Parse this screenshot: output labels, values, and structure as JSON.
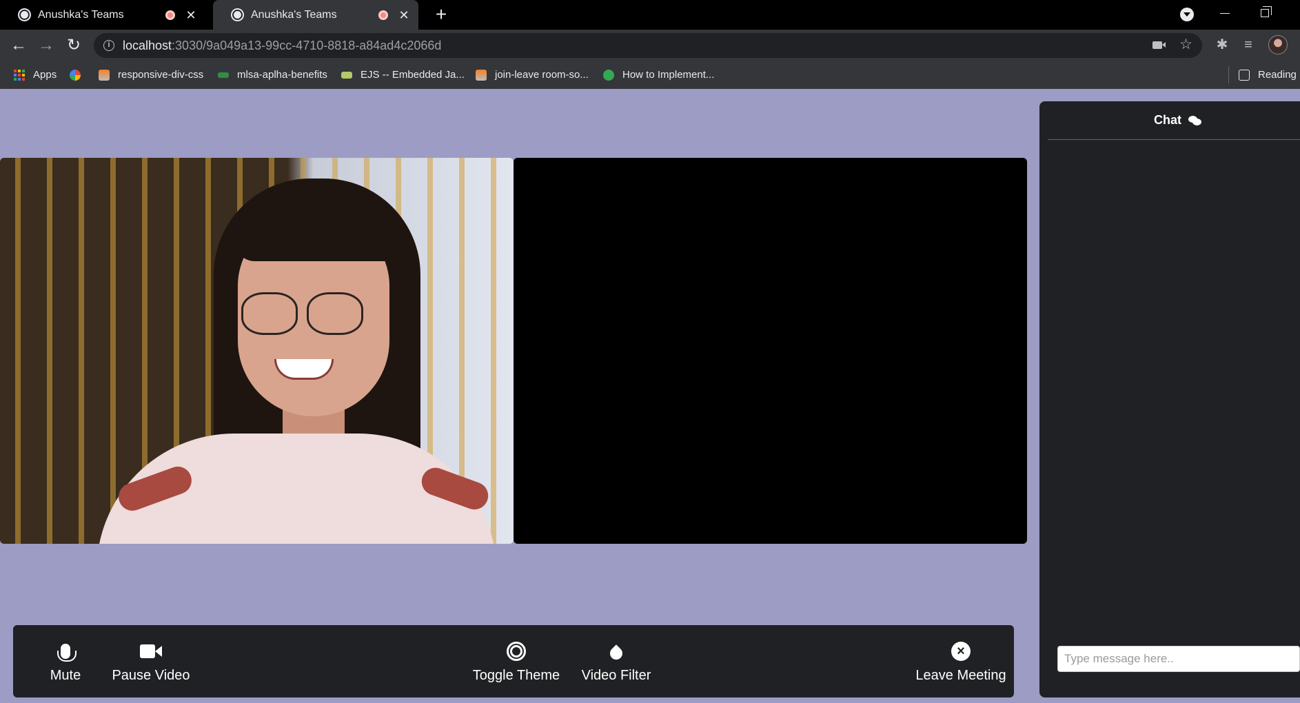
{
  "browser": {
    "tabs": [
      {
        "title": "Anushka's Teams",
        "active": false
      },
      {
        "title": "Anushka's Teams",
        "active": true
      }
    ],
    "new_tab_icon": "plus-icon",
    "url": {
      "host": "localhost",
      "path": ":3030/9a049a13-99cc-4710-8818-a84ad4c2066d"
    },
    "bookmarks": [
      {
        "label": "Apps",
        "icon": "apps-grid-icon"
      },
      {
        "label": "",
        "icon": "pinwheel-icon"
      },
      {
        "label": "responsive-div-css",
        "icon": "stackoverflow-icon"
      },
      {
        "label": "mlsa-aplha-benefits",
        "icon": "gfg-icon"
      },
      {
        "label": "EJS -- Embedded Ja...",
        "icon": "ejs-icon"
      },
      {
        "label": "join-leave room-so...",
        "icon": "stackoverflow-icon"
      },
      {
        "label": "How to Implement...",
        "icon": "green-globe-icon"
      },
      {
        "label": "Reading l",
        "icon": "reading-list-icon"
      }
    ]
  },
  "meeting": {
    "controls": {
      "mute": "Mute",
      "pause_video": "Pause Video",
      "toggle_theme": "Toggle Theme",
      "video_filter": "Video Filter",
      "leave_meeting": "Leave Meeting"
    },
    "chat": {
      "title": "Chat",
      "input_placeholder": "Type message here.."
    }
  },
  "colors": {
    "app_background": "#9c9cc4",
    "panel_background": "#202124",
    "browser_dark": "#000000",
    "toolbar": "#35363a"
  }
}
